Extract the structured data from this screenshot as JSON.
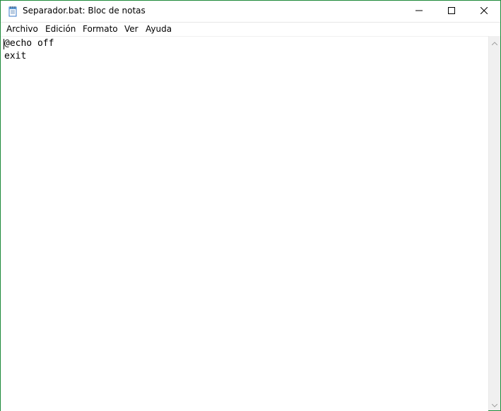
{
  "window": {
    "title": "Separador.bat: Bloc de notas",
    "accent_color": "#1e8a3a"
  },
  "titlebar": {
    "icon": "notepad-icon",
    "buttons": [
      "minimize-icon",
      "maximize-icon",
      "close-icon"
    ]
  },
  "menubar": {
    "items": [
      {
        "label": "Archivo"
      },
      {
        "label": "Edición"
      },
      {
        "label": "Formato"
      },
      {
        "label": "Ver"
      },
      {
        "label": "Ayuda"
      }
    ]
  },
  "editor": {
    "lines": [
      "@echo off",
      "exit"
    ]
  }
}
